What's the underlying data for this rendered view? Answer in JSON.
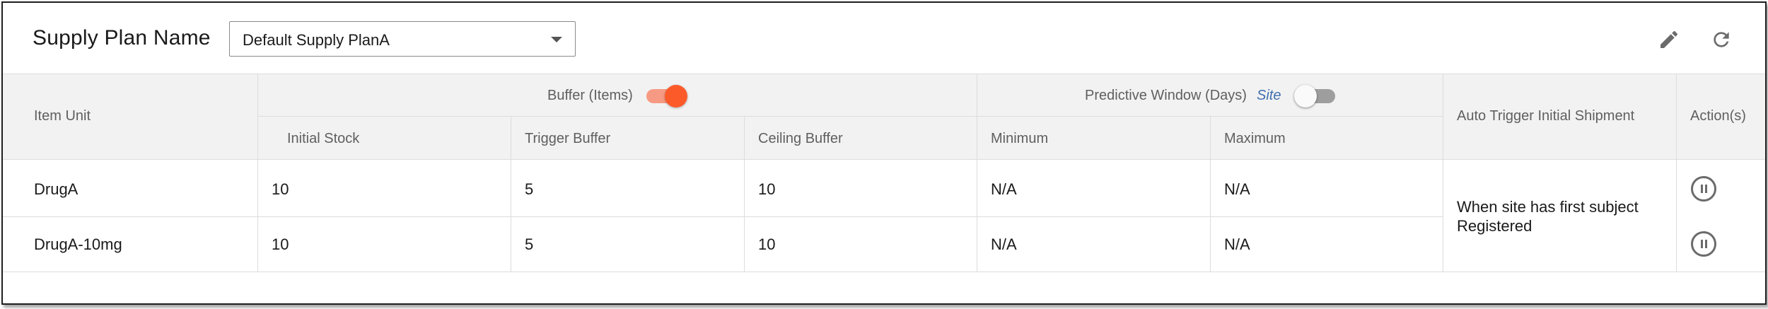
{
  "header": {
    "plan_label": "Supply Plan Name",
    "plan_select": {
      "value": "Default Supply PlanA"
    },
    "icons": {
      "edit": "pencil-icon",
      "refresh": "refresh-icon"
    }
  },
  "table": {
    "col_item_unit": "Item Unit",
    "group_buffer": {
      "label": "Buffer (Items)",
      "toggle_on": true
    },
    "group_predictive": {
      "label": "Predictive Window (Days)",
      "site_label": "Site",
      "toggle_on": false
    },
    "col_auto_trigger": "Auto Trigger Initial Shipment",
    "col_actions": "Action(s)",
    "sub_columns": {
      "initial_stock": "Initial Stock",
      "trigger_buffer": "Trigger Buffer",
      "ceiling_buffer": "Ceiling Buffer",
      "minimum": "Minimum",
      "maximum": "Maximum"
    },
    "rows": [
      {
        "item_unit": "DrugA",
        "initial_stock": "10",
        "trigger_buffer": "5",
        "ceiling_buffer": "10",
        "minimum": "N/A",
        "maximum": "N/A",
        "action_icon": "pause-circle-icon"
      },
      {
        "item_unit": "DrugA-10mg",
        "initial_stock": "10",
        "trigger_buffer": "5",
        "ceiling_buffer": "10",
        "minimum": "N/A",
        "maximum": "N/A",
        "action_icon": "pause-circle-icon"
      }
    ],
    "auto_trigger_value_line1": "When site has first subject",
    "auto_trigger_value_line2": "Registered"
  },
  "colors": {
    "accent": "#fd5a2a",
    "accent_track": "#f79a84",
    "header_bg": "#f2f2f2",
    "site_link": "#3f6fb0"
  }
}
